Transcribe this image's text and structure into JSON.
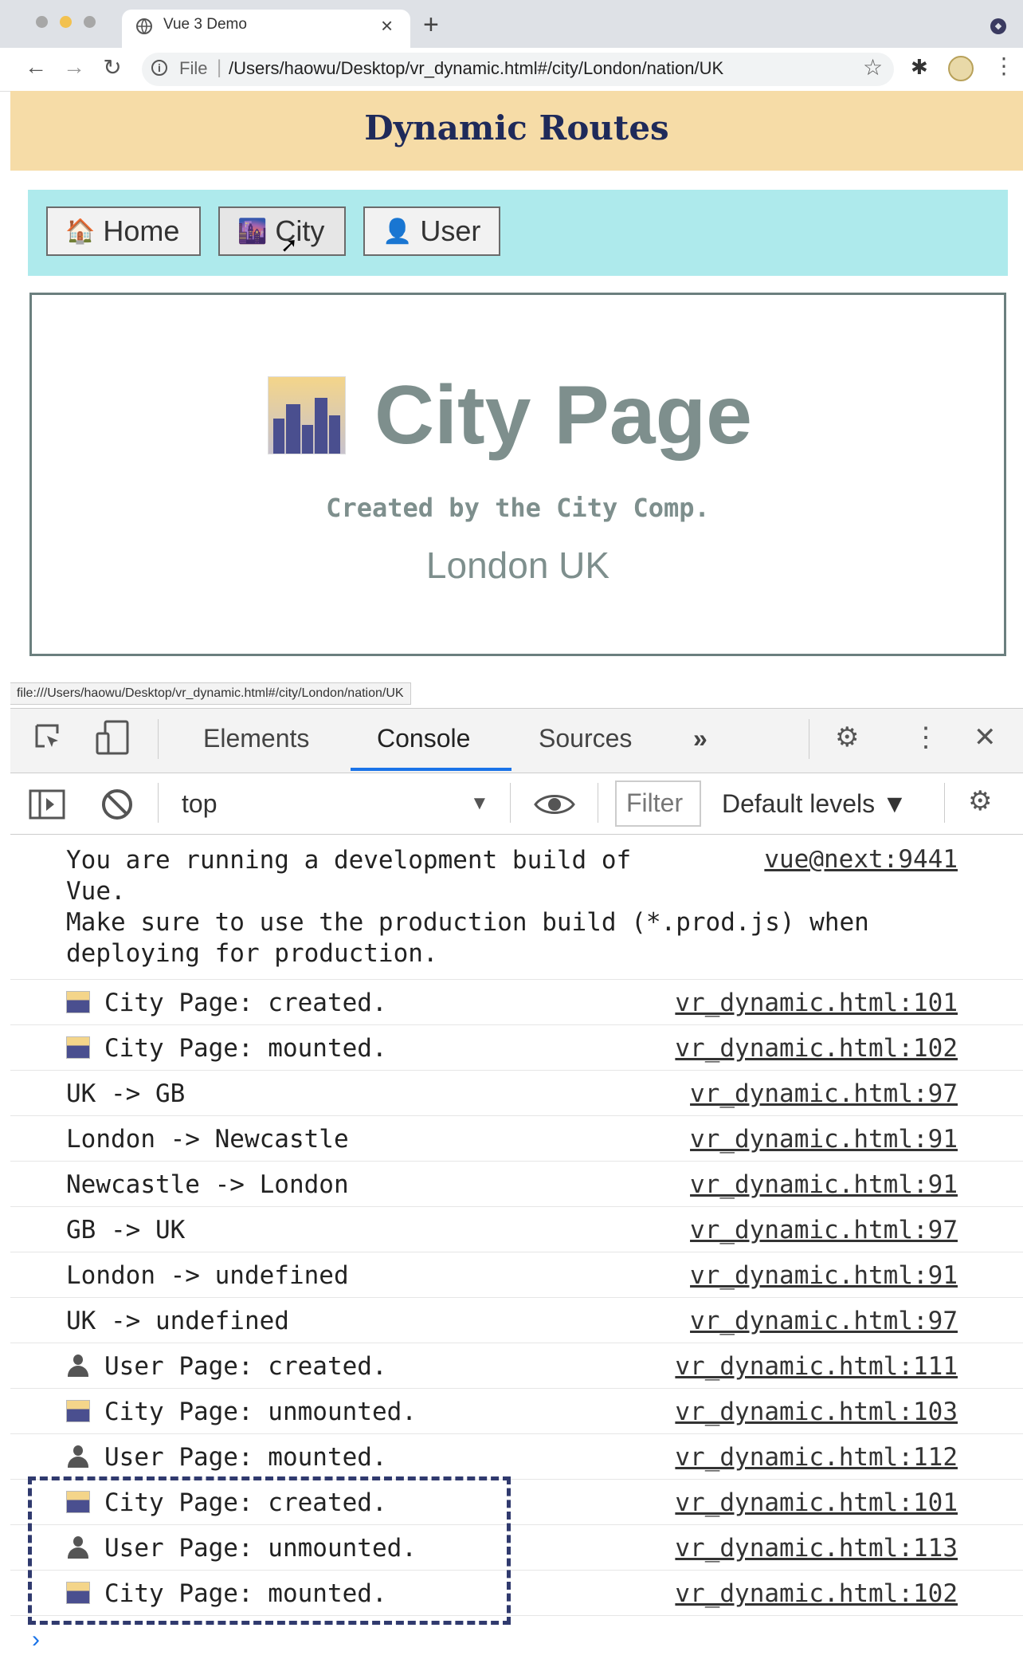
{
  "browser": {
    "tab_title": "Vue 3 Demo",
    "url_scheme": "File",
    "url": "/Users/haowu/Desktop/vr_dynamic.html#/city/London/nation/UK",
    "status_url": "file:///Users/haowu/Desktop/vr_dynamic.html#/city/London/nation/UK"
  },
  "app": {
    "title": "Dynamic Routes",
    "nav": [
      {
        "label": "Home",
        "icon": "🏠"
      },
      {
        "label": "City",
        "icon": "🌆"
      },
      {
        "label": "User",
        "icon": "👤"
      }
    ],
    "city_page": {
      "title": "City Page",
      "subtitle": "Created by the City Comp.",
      "location": "London UK"
    }
  },
  "devtools": {
    "tabs": [
      "Elements",
      "Console",
      "Sources"
    ],
    "more_tabs": "»",
    "context": "top",
    "filter_placeholder": "Filter",
    "levels": "Default levels ▼",
    "logs": [
      {
        "msg": "You are running a development build of\nVue.\nMake sure to use the production build (*.prod.js) when\ndeploying for production.",
        "src": "vue@next:9441",
        "icon": "none"
      },
      {
        "msg": "City Page: created.",
        "src": "vr_dynamic.html:101",
        "icon": "city"
      },
      {
        "msg": "City Page: mounted.",
        "src": "vr_dynamic.html:102",
        "icon": "city"
      },
      {
        "msg": "UK -> GB",
        "src": "vr_dynamic.html:97",
        "icon": "none"
      },
      {
        "msg": "London -> Newcastle",
        "src": "vr_dynamic.html:91",
        "icon": "none"
      },
      {
        "msg": "Newcastle -> London",
        "src": "vr_dynamic.html:91",
        "icon": "none"
      },
      {
        "msg": "GB -> UK",
        "src": "vr_dynamic.html:97",
        "icon": "none"
      },
      {
        "msg": "London -> undefined",
        "src": "vr_dynamic.html:91",
        "icon": "none"
      },
      {
        "msg": "UK -> undefined",
        "src": "vr_dynamic.html:97",
        "icon": "none"
      },
      {
        "msg": "User Page: created.",
        "src": "vr_dynamic.html:111",
        "icon": "user"
      },
      {
        "msg": "City Page: unmounted.",
        "src": "vr_dynamic.html:103",
        "icon": "city"
      },
      {
        "msg": "User Page: mounted.",
        "src": "vr_dynamic.html:112",
        "icon": "user"
      },
      {
        "msg": "City Page: created.",
        "src": "vr_dynamic.html:101",
        "icon": "city"
      },
      {
        "msg": "User Page: unmounted.",
        "src": "vr_dynamic.html:113",
        "icon": "user"
      },
      {
        "msg": "City Page: mounted.",
        "src": "vr_dynamic.html:102",
        "icon": "city"
      }
    ],
    "prompt": "›"
  },
  "colors": {
    "header_bg": "#f6dca7",
    "nav_bg": "#aeeaec",
    "title_text": "#1f2a5a",
    "page_text": "#7e8f8d",
    "highlight_border": "#303a6e"
  }
}
